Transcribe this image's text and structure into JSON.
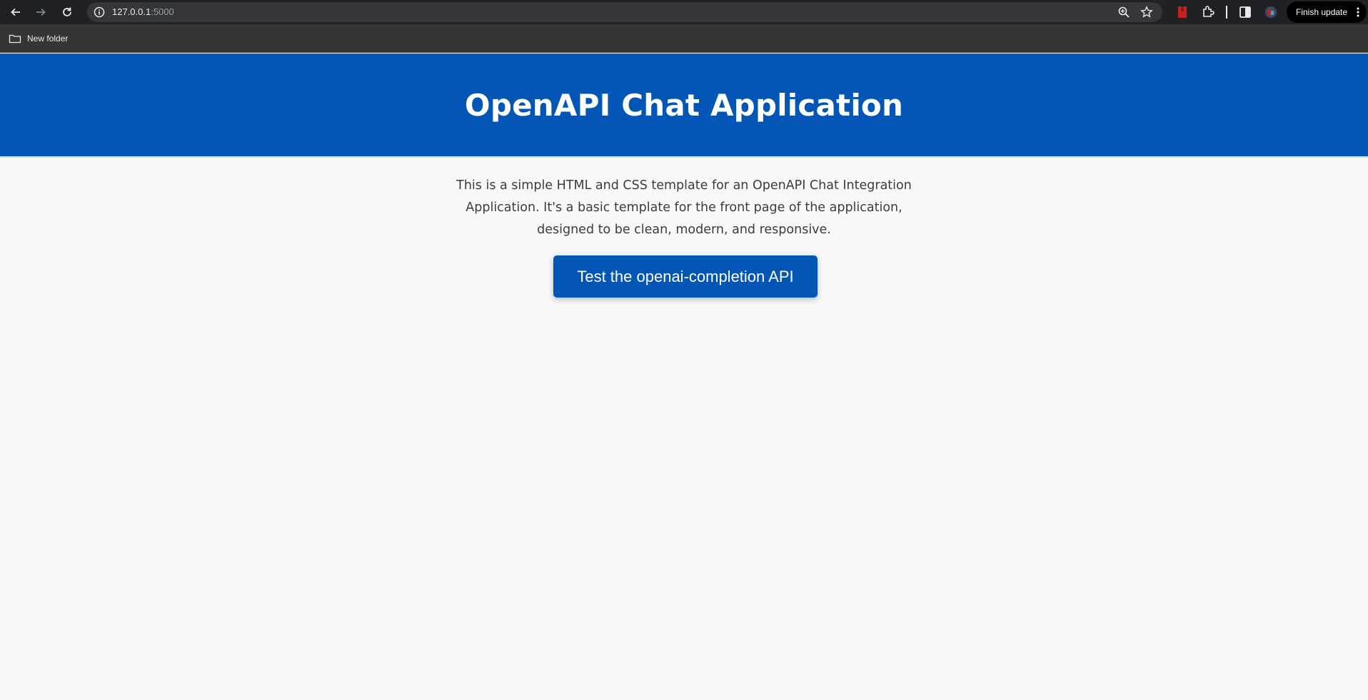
{
  "browser": {
    "url_host": "127.0.0.1",
    "url_port": ":5000",
    "finish_update_label": "Finish update",
    "bookmarks": [
      {
        "label": "New folder",
        "icon": "folder-icon"
      }
    ],
    "icons": [
      "back-icon",
      "forward-icon",
      "reload-icon",
      "site-info-icon",
      "zoom-icon",
      "bookmark-star-icon",
      "extension-bookmark-icon",
      "extensions-puzzle-icon",
      "side-panel-icon",
      "profile-icon",
      "menu-dots-icon"
    ]
  },
  "page": {
    "title": "OpenAPI Chat Application",
    "description": "This is a simple HTML and CSS template for an OpenAPI Chat Integration Application. It's a basic template for the front page of the application, designed to be clean, modern, and responsive.",
    "cta_label": "Test the openai-completion API"
  },
  "colors": {
    "header_bg": "#0356b5",
    "page_bg": "#f7f8fa",
    "button_bg": "#0356b5",
    "chrome_bg": "#202124",
    "bookmarks_bg": "#353535"
  }
}
